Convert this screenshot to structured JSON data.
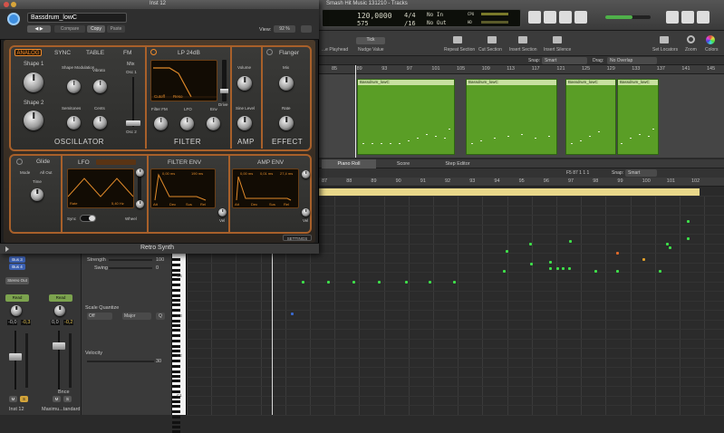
{
  "daw": {
    "window_title": "Smash Hit Music 131210 - Tracks",
    "lcd": {
      "bar": "120,0000",
      "bpm": "120,0000",
      "sig_top": "4/4",
      "sig_bottom": "/16",
      "key": "575",
      "in": "No In",
      "out": "No Out",
      "cpu": "CPU",
      "hd": "HD"
    },
    "toolbar": [
      "Repeat Section",
      "Cut Section",
      "Insert Section",
      "Insert Silence",
      "Set Locators",
      "Zoom",
      "Colors"
    ],
    "toolbar_left": [
      "...e Playhead",
      "Nudge Value"
    ],
    "nudge_value": "Tick",
    "snap_label": "Snap:",
    "snap_value": "Smart",
    "drag_label": "Drag:",
    "drag_value": "No Overlap",
    "ruler_top": [
      "85",
      "89",
      "93",
      "97",
      "101",
      "105",
      "109",
      "113",
      "117",
      "121",
      "125",
      "129",
      "133",
      "137",
      "141",
      "145"
    ],
    "regions": [
      "Bassdrum_lowC",
      "Bassdrum_lowC",
      "Bassdrum_lowC",
      "Bassdrum_lowC"
    ],
    "editor_tabs": [
      "Piano Roll",
      "Score",
      "Step Editor"
    ],
    "editor_pos": "F5  87 1 1 1",
    "editor_snap_label": "Snap:",
    "editor_snap_value": "Smart",
    "ruler_bottom": [
      "87",
      "88",
      "89",
      "90",
      "91",
      "92",
      "93",
      "94",
      "95",
      "96",
      "97",
      "98",
      "99",
      "100",
      "101",
      "102"
    ],
    "piano_labels": [
      "C4",
      "C3",
      "C2",
      "C1"
    ],
    "editor_left": {
      "strength": "Strength",
      "strength_val": "100",
      "swing": "Swing",
      "swing_val": "0",
      "scale_quantize": "Scale Quantize",
      "scale_off": "Off",
      "scale_major": "Major",
      "scale_q": "Q",
      "velocity": "Velocity",
      "velocity_val": "30"
    },
    "mixer": {
      "bus3": "Bus 3",
      "bus4": "Bus 4",
      "stereo_out": "Stereo Out",
      "read": "Read",
      "read2": "Read",
      "val1": "-0,0",
      "val2": "-0,3",
      "val3": "0,0",
      "val4": "-0,2",
      "m": "M",
      "s": "S",
      "m2": "M",
      "s2": "S",
      "bnce": "Bnce",
      "name1": "Inst 12",
      "name2": "Maximu...tandard"
    }
  },
  "synth": {
    "window_title": "Inst 12",
    "preset": "Bassdrum_lowC",
    "compare": "Compare",
    "copy": "Copy",
    "paste": "Paste",
    "view_label": "View:",
    "view_value": "92 %",
    "tabs": {
      "analog": "ANALOG",
      "sync": "SYNC",
      "table": "TABLE",
      "fm": "FM"
    },
    "osc": {
      "shape1": "Shape 1",
      "shape2": "Shape 2",
      "shape_mod": "Shape Modulation",
      "vibrato": "Vibrato",
      "semitones": "Semitones",
      "cents": "Cents",
      "mix": "Mix",
      "osc1": "Osc 1",
      "osc2": "Osc 2",
      "section": "OSCILLATOR"
    },
    "filter": {
      "type": "LP 24dB",
      "cutoff": "Cutoff",
      "reso": "Reso",
      "filter_fm": "Filter FM",
      "lfo": "LFO",
      "env": "Env",
      "drive": "Drive",
      "section": "FILTER"
    },
    "amp": {
      "volume": "Volume",
      "sine_level": "Sine Level",
      "section": "AMP"
    },
    "effect": {
      "type": "Flanger",
      "mix": "Mix",
      "rate": "Rate",
      "section": "EFFECT"
    },
    "glide": {
      "title": "Glide",
      "mode": "Mode",
      "mode_val": "All Out",
      "time": "Time"
    },
    "lfo": {
      "title": "LFO",
      "sync": "Sync",
      "wheel": "Wheel",
      "rate": "Rate",
      "rate_val": "5,40 Hz"
    },
    "filter_env": {
      "title": "FILTER ENV",
      "a_val": "0,00 ms",
      "d_val": "190 ms",
      "vel": "Vel",
      "att": "Att",
      "dec": "Dec",
      "sus": "Sus",
      "rel": "Rel"
    },
    "amp_env": {
      "title": "AMP ENV",
      "a_val": "0,00 ms",
      "d_val": "0,01 ms",
      "r_val": "27,4 ms",
      "vel": "Vel",
      "att": "Att",
      "dec": "Dec",
      "sus": "Sus",
      "rel": "Rel"
    },
    "settings": "SETTINGS",
    "name": "Retro Synth"
  }
}
